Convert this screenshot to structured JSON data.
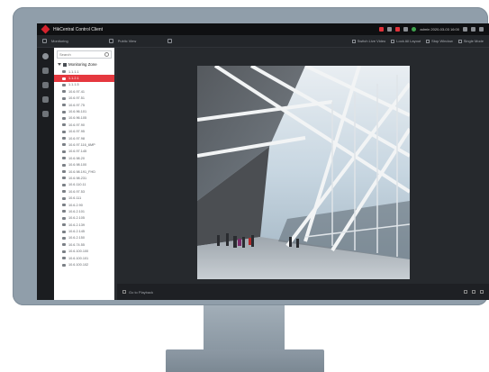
{
  "app": {
    "title": "HikCentral Control Client",
    "user": "admin  2020-03-03 16:00"
  },
  "toolbar": {
    "module": "Monitoring",
    "view": "Public View",
    "actions": [
      "Switch Live Video",
      "Lock All Layout",
      "Stop Window",
      "Single Mode"
    ]
  },
  "device_panel": {
    "search_placeholder": "Search",
    "group": "Monitoring Zone",
    "items": [
      "1.1.1.1",
      "1.1.2.1",
      "1.1.1.5",
      "10.6.97.41",
      "10.6.97.51",
      "10.6.97.75",
      "10.6.96.101",
      "10.6.96.105",
      "10.6.97.90",
      "10.6.97.95",
      "10.6.97.98",
      "10.6.97.116_6MP",
      "10.6.97.145",
      "10.6.98.20",
      "10.6.98.100",
      "10.6.98.191_FHD",
      "10.6.98.231",
      "10.6.110.11",
      "10.6.97.53",
      "10.6.111",
      "10.6.2.90",
      "10.6.2.101",
      "10.6.2.105",
      "10.6.2.139",
      "10.6.2.145",
      "10.6.2.150",
      "10.6.74.55",
      "10.6.100.100",
      "10.6.100.101",
      "10.6.100.102"
    ],
    "active_index": 1
  },
  "bottombar": {
    "label": "Go to Playback"
  },
  "colors": {
    "accent": "#e5383f",
    "bezel": "#909eaa",
    "screen_bg": "#1b1d20"
  }
}
